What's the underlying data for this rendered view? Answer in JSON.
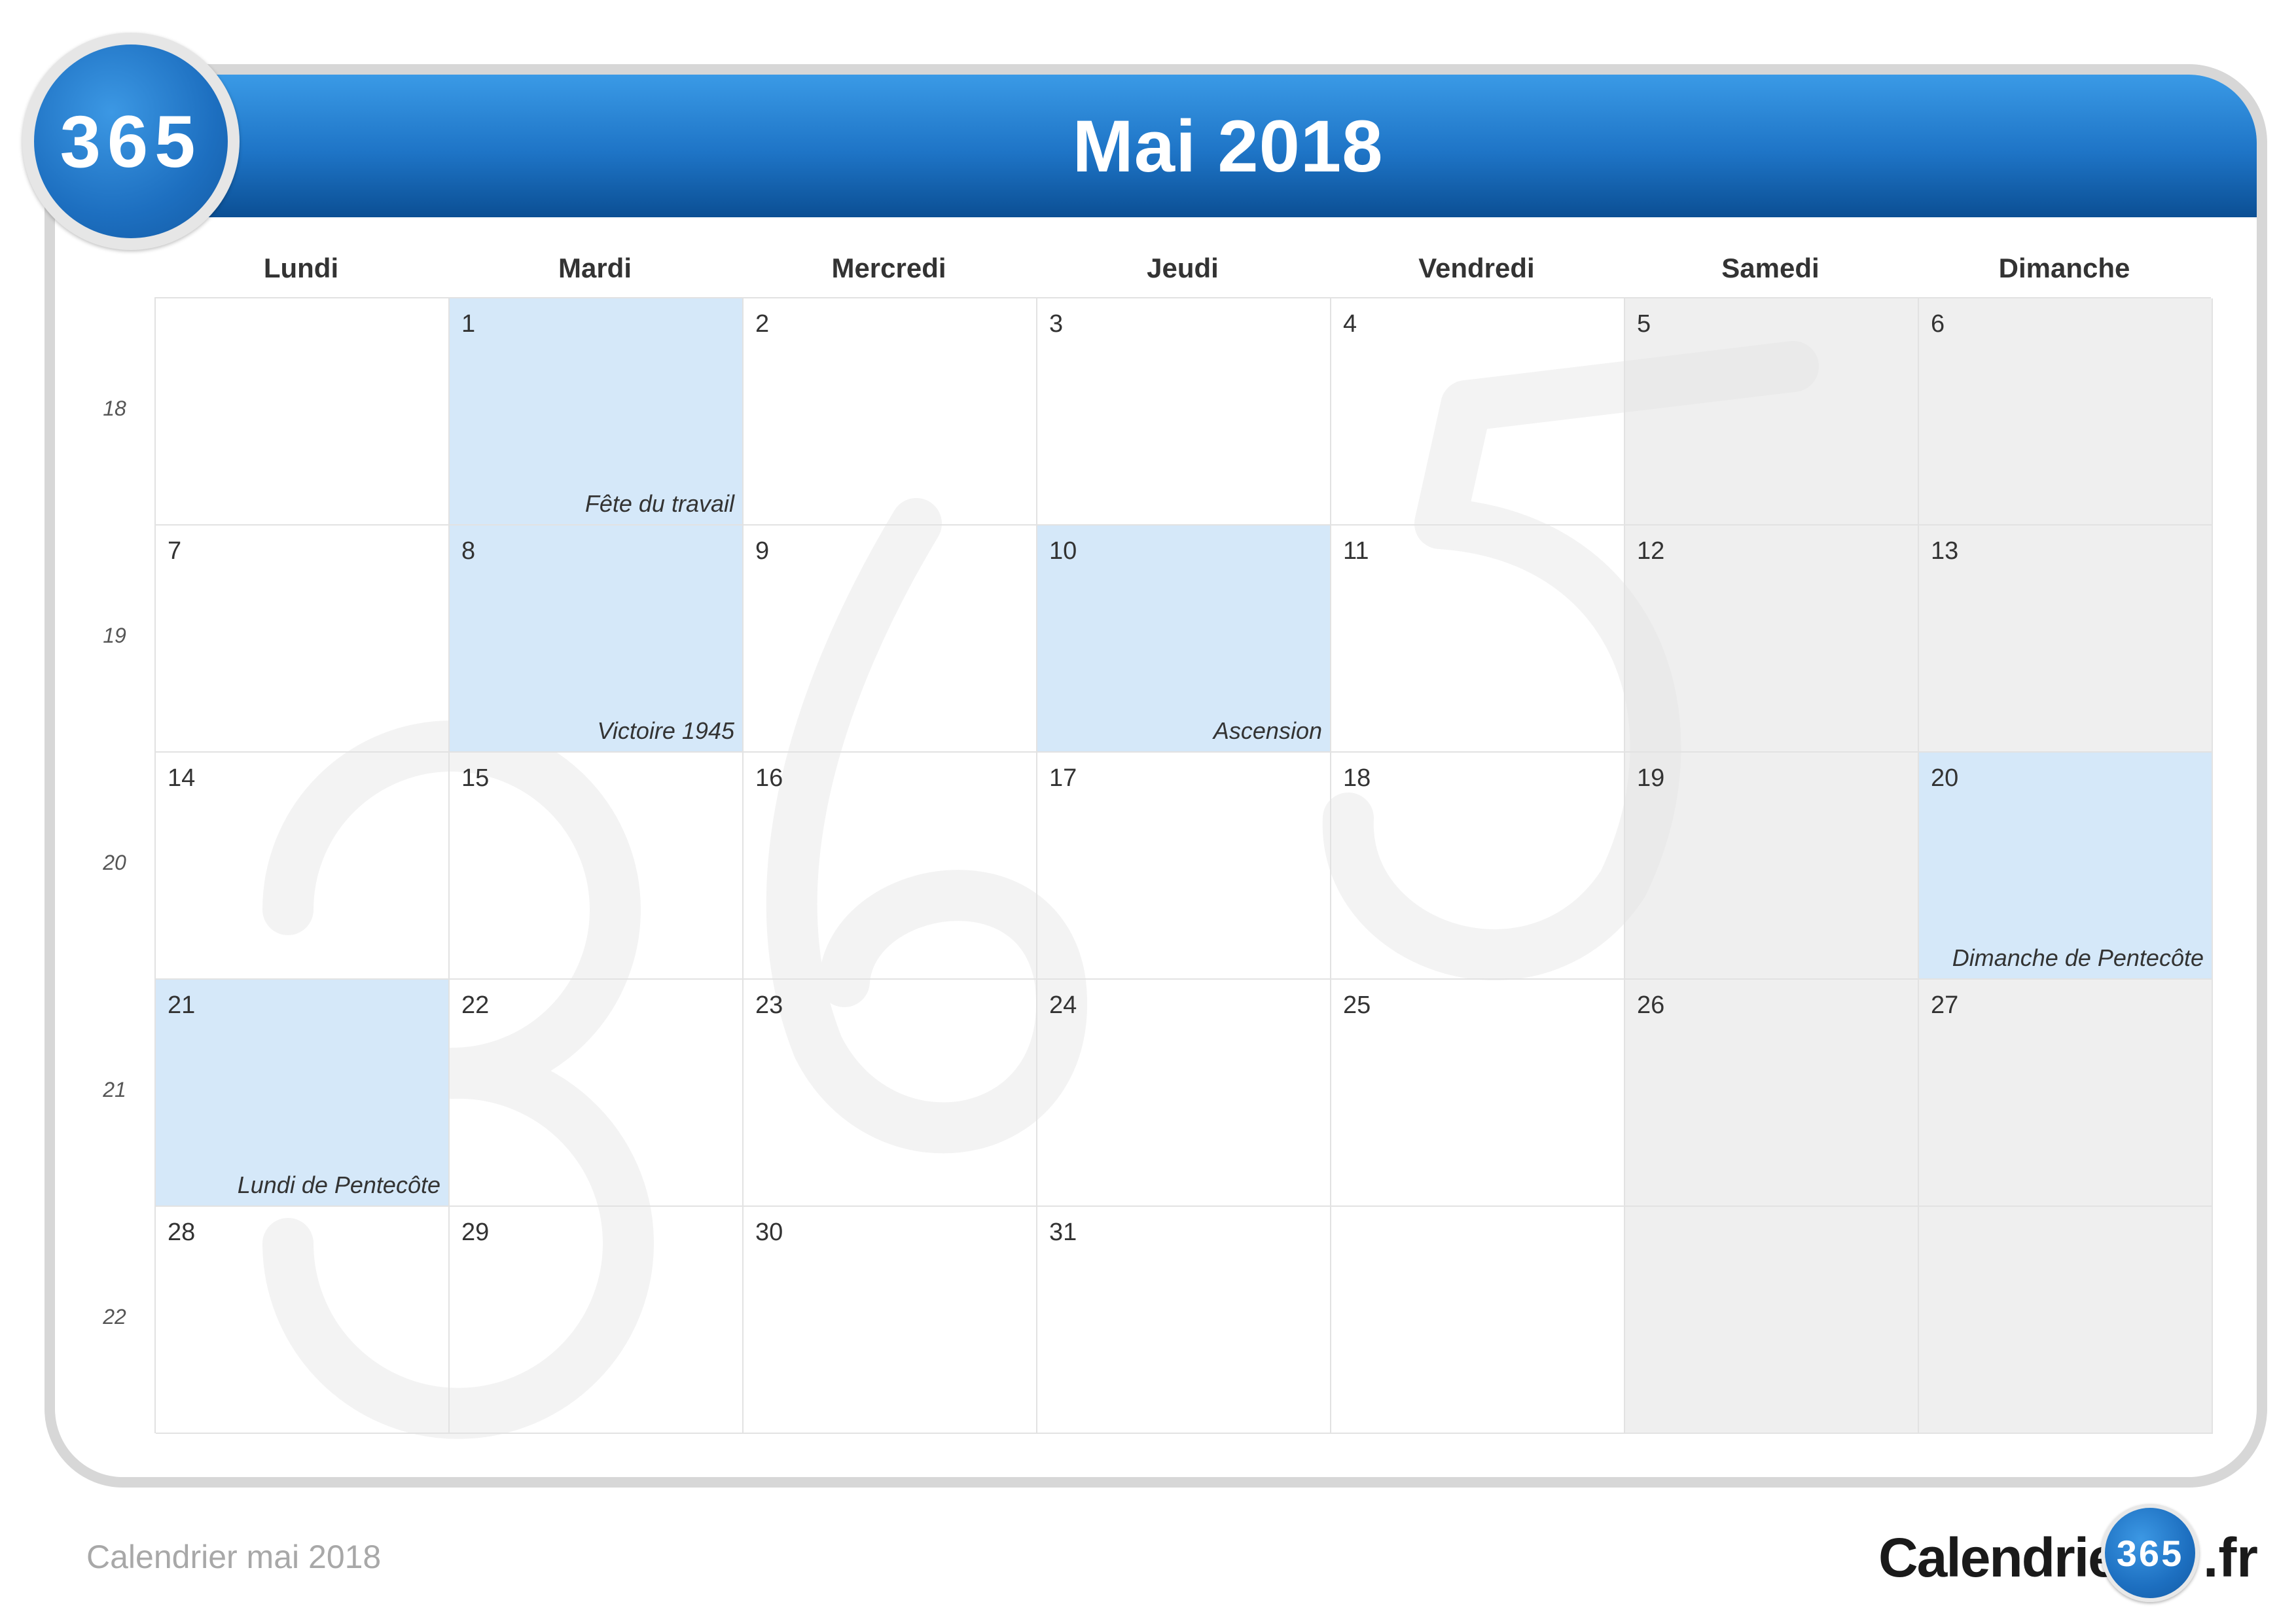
{
  "header": {
    "badge": "365",
    "title": "Mai 2018",
    "accent_color": "#1e74c6"
  },
  "weekdays": [
    "Lundi",
    "Mardi",
    "Mercredi",
    "Jeudi",
    "Vendredi",
    "Samedi",
    "Dimanche"
  ],
  "week_numbers": [
    "18",
    "19",
    "20",
    "21",
    "22"
  ],
  "weeks": [
    [
      {
        "day": "",
        "holiday": ""
      },
      {
        "day": "1",
        "holiday": "Fête du travail"
      },
      {
        "day": "2",
        "holiday": ""
      },
      {
        "day": "3",
        "holiday": ""
      },
      {
        "day": "4",
        "holiday": ""
      },
      {
        "day": "5",
        "holiday": ""
      },
      {
        "day": "6",
        "holiday": ""
      }
    ],
    [
      {
        "day": "7",
        "holiday": ""
      },
      {
        "day": "8",
        "holiday": "Victoire 1945"
      },
      {
        "day": "9",
        "holiday": ""
      },
      {
        "day": "10",
        "holiday": "Ascension"
      },
      {
        "day": "11",
        "holiday": ""
      },
      {
        "day": "12",
        "holiday": ""
      },
      {
        "day": "13",
        "holiday": ""
      }
    ],
    [
      {
        "day": "14",
        "holiday": ""
      },
      {
        "day": "15",
        "holiday": ""
      },
      {
        "day": "16",
        "holiday": ""
      },
      {
        "day": "17",
        "holiday": ""
      },
      {
        "day": "18",
        "holiday": ""
      },
      {
        "day": "19",
        "holiday": ""
      },
      {
        "day": "20",
        "holiday": "Dimanche de Pentecôte"
      }
    ],
    [
      {
        "day": "21",
        "holiday": "Lundi de Pentecôte"
      },
      {
        "day": "22",
        "holiday": ""
      },
      {
        "day": "23",
        "holiday": ""
      },
      {
        "day": "24",
        "holiday": ""
      },
      {
        "day": "25",
        "holiday": ""
      },
      {
        "day": "26",
        "holiday": ""
      },
      {
        "day": "27",
        "holiday": ""
      }
    ],
    [
      {
        "day": "28",
        "holiday": ""
      },
      {
        "day": "29",
        "holiday": ""
      },
      {
        "day": "30",
        "holiday": ""
      },
      {
        "day": "31",
        "holiday": ""
      },
      {
        "day": "",
        "holiday": ""
      },
      {
        "day": "",
        "holiday": ""
      },
      {
        "day": "",
        "holiday": ""
      }
    ]
  ],
  "footer": {
    "caption": "Calendrier mai 2018",
    "brand_text": "Calendrier-",
    "brand_badge": "365",
    "brand_tld": ".fr"
  },
  "colors": {
    "holiday_fill": "#d5e8f9",
    "weekend_fill": "#f0f0f0",
    "header_gradient_top": "#3a9ae6",
    "header_gradient_bottom": "#0b4f94"
  }
}
